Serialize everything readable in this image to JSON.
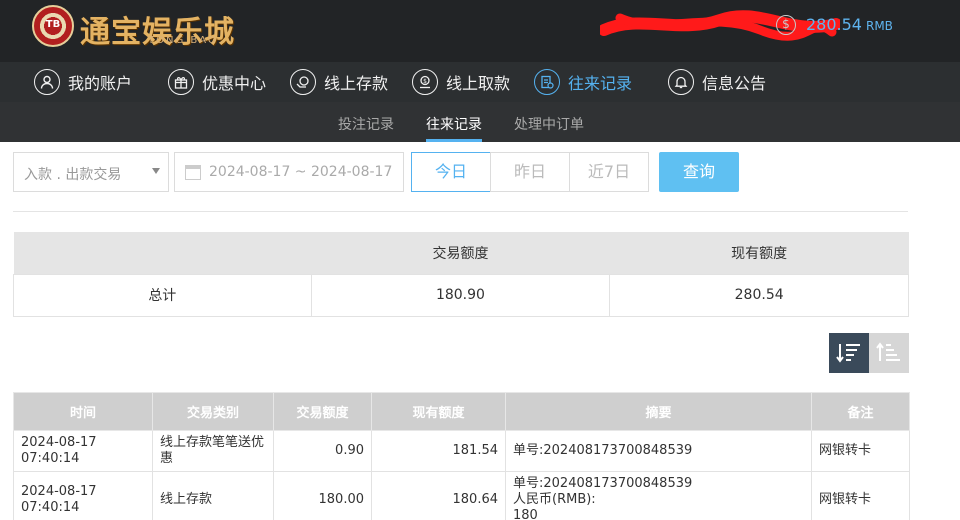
{
  "header": {
    "logo_badge": "TB",
    "logo_name": "通宝娱乐城",
    "logo_sub": "TONG BAO",
    "balance": "280.54",
    "currency": "RMB",
    "coin_icon": "dollar-coin-icon"
  },
  "nav": {
    "items": [
      {
        "label": "我的账户",
        "icon": "user-icon"
      },
      {
        "label": "优惠中心",
        "icon": "gift-icon"
      },
      {
        "label": "线上存款",
        "icon": "deposit-icon"
      },
      {
        "label": "线上取款",
        "icon": "withdraw-icon"
      },
      {
        "label": "往来记录",
        "icon": "records-icon"
      },
      {
        "label": "信息公告",
        "icon": "bell-icon"
      }
    ],
    "active_index": 4
  },
  "subnav": {
    "tabs": [
      "投注记录",
      "往来记录",
      "处理中订单"
    ],
    "active_index": 1
  },
  "filters": {
    "type_select": "入款 . 出款交易",
    "date_range": "2024-08-17 ~ 2024-08-17",
    "periods": [
      "今日",
      "昨日",
      "近7日"
    ],
    "active_period": 0,
    "query_label": "查询"
  },
  "summary": {
    "headers": [
      "",
      "交易额度",
      "现有额度"
    ],
    "row": [
      "总计",
      "180.90",
      "280.54"
    ]
  },
  "sort": {
    "desc_icon": "sort-descending-icon",
    "asc_icon": "sort-ascending-icon",
    "active": "desc"
  },
  "records": {
    "headers": [
      "时间",
      "交易类别",
      "交易额度",
      "现有额度",
      "摘要",
      "备注"
    ],
    "rows": [
      [
        "2024-08-17 07:40:14",
        "线上存款笔笔送优惠",
        "0.90",
        "181.54",
        "单号:202408173700848539",
        "网银转卡"
      ],
      [
        "2024-08-17 07:40:14",
        "线上存款",
        "180.00",
        "180.64",
        "单号:202408173700848539\n人民币(RMB):\n180",
        "网银转卡"
      ]
    ]
  },
  "colors": {
    "accent": "#55b2f0",
    "header_bg": "#222426",
    "nav_bg": "#2c2f31",
    "query_btn": "#5fc0f2"
  }
}
